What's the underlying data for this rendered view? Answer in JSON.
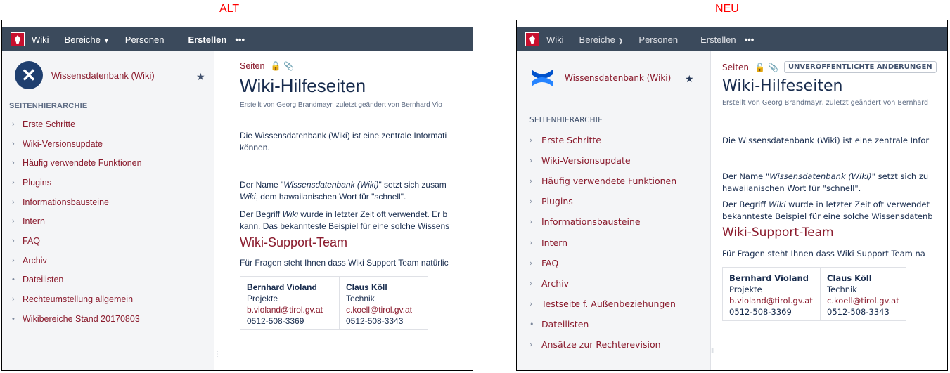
{
  "captions": {
    "alt": "ALT",
    "neu": "NEU"
  },
  "colors": {
    "topbar": "#3b4a5c",
    "link": "#8a1b2d",
    "caption": "#ff0000",
    "sidebar": "#f4f5f7"
  },
  "alt": {
    "topbar": {
      "wiki": "Wiki",
      "bereiche": "Bereiche",
      "personen": "Personen",
      "erstellen": "Erstellen",
      "more": "•••"
    },
    "sidebar": {
      "space_name": "Wissensdatenbank (Wiki)",
      "heading": "SEITENHIERARCHIE",
      "items": [
        {
          "label": "Erste Schritte",
          "marker": "›"
        },
        {
          "label": "Wiki-Versionsupdate",
          "marker": "›"
        },
        {
          "label": "Häufig verwendete Funktionen",
          "marker": "›"
        },
        {
          "label": "Plugins",
          "marker": "›"
        },
        {
          "label": "Informationsbausteine",
          "marker": "›"
        },
        {
          "label": "Intern",
          "marker": "›"
        },
        {
          "label": "FAQ",
          "marker": "›"
        },
        {
          "label": "Archiv",
          "marker": "›"
        },
        {
          "label": "Dateilisten",
          "marker": "•"
        },
        {
          "label": "Rechteumstellung allgemein",
          "marker": "›"
        },
        {
          "label": "Wikibereiche Stand 20170803",
          "marker": "•"
        }
      ]
    },
    "content": {
      "crumb": "Seiten",
      "title": "Wiki-Hilfeseiten",
      "byline": "Erstellt von Georg Brandmayr, zuletzt geändert von Bernhard Vio",
      "p1_line1": "Die Wissensdatenbank (Wiki) ist eine zentrale Informati",
      "p1_line2": "können.",
      "p2_pre": "Der Name \"",
      "p2_em": "Wissensdatenbank (Wiki)",
      "p2_post": "\" setzt sich zusam",
      "p2_line2_em": "Wiki",
      "p2_line2_post": ", dem hawaiianischen Wort für \"schnell\".",
      "p3_pre": "Der Begriff ",
      "p3_em": "Wiki",
      "p3_post": " wurde in letzter Zeit oft verwendet. Er b",
      "p3_line2": "kann. Das bekannteste Beispiel für eine solche Wissens",
      "h2": "Wiki-Support-Team",
      "p4": "Für Fragen steht Ihnen dass Wiki Support Team natürlic",
      "contacts": [
        {
          "name": "Bernhard Violand",
          "role": "Projekte",
          "email": "b.violand@tirol.gv.at",
          "phone": "0512-508-3369"
        },
        {
          "name": "Claus Köll",
          "role": "Technik",
          "email": "c.koell@tirol.gv.at",
          "phone": "0512-508-3343"
        }
      ]
    }
  },
  "neu": {
    "topbar": {
      "wiki": "Wiki",
      "bereiche": "Bereiche",
      "personen": "Personen",
      "erstellen": "Erstellen",
      "more": "•••"
    },
    "sidebar": {
      "space_name": "Wissensdatenbank (Wiki)",
      "heading": "SEITENHIERARCHIE",
      "items": [
        {
          "label": "Erste Schritte",
          "marker": "›"
        },
        {
          "label": "Wiki-Versionsupdate",
          "marker": "›"
        },
        {
          "label": "Häufig verwendete Funktionen",
          "marker": "›"
        },
        {
          "label": "Plugins",
          "marker": "›"
        },
        {
          "label": "Informationsbausteine",
          "marker": "›"
        },
        {
          "label": "Intern",
          "marker": "›"
        },
        {
          "label": "FAQ",
          "marker": "›"
        },
        {
          "label": "Archiv",
          "marker": "›"
        },
        {
          "label": "Testseite f. Außenbeziehungen",
          "marker": "›"
        },
        {
          "label": "Dateilisten",
          "marker": "•"
        },
        {
          "label": "Ansätze zur Rechterevision",
          "marker": "›"
        }
      ]
    },
    "content": {
      "crumb": "Seiten",
      "badge": "UNVERÖFFENTLICHTE ÄNDERUNGEN",
      "title": "Wiki-Hilfeseiten",
      "byline": "Erstellt von Georg Brandmayr, zuletzt geändert von Bernhard",
      "p1_line1": "Die Wissensdatenbank (Wiki) ist eine zentrale Infor",
      "p2_pre": "Der Name \"",
      "p2_em": "Wissensdatenbank (Wiki)",
      "p2_post": "\" setzt sich zu",
      "p2_line2": "hawaiianischen Wort für \"schnell\".",
      "p3_pre": "Der Begriff ",
      "p3_em": "Wiki",
      "p3_post": " wurde in letzter Zeit oft verwendet",
      "p3_line2": "bekannteste Beispiel für eine solche Wissensdatenb",
      "h2": "Wiki-Support-Team",
      "p4": "Für Fragen steht Ihnen dass Wiki Support Team na",
      "contacts": [
        {
          "name": "Bernhard Violand",
          "role": "Projekte",
          "email": "b.violand@tirol.gv.at",
          "phone": "0512-508-3369"
        },
        {
          "name": "Claus Köll",
          "role": "Technik",
          "email": "c.koell@tirol.gv.at",
          "phone": "0512-508-3343"
        }
      ]
    }
  }
}
